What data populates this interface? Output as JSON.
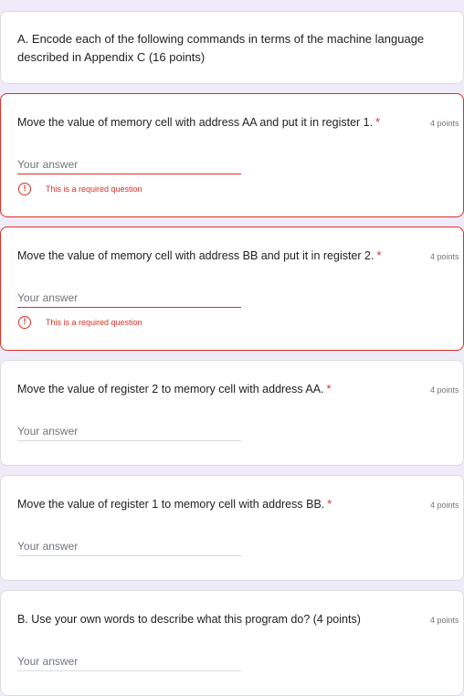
{
  "section_a": {
    "text": "A. Encode each of the following commands in terms of the machine language described in Appendix C (16 points)"
  },
  "questions": [
    {
      "title": "Move the value of memory cell with address AA and put it in register 1.",
      "required_mark": "*",
      "points": "4 points",
      "placeholder": "Your answer",
      "error": "This is a required question",
      "error_icon": "exclamation-circle-icon"
    },
    {
      "title": "Move the value of memory cell with address BB and put it in register 2.",
      "required_mark": "*",
      "points": "4 points",
      "placeholder": "Your answer",
      "error": "This is a required question",
      "error_icon": "exclamation-circle-icon"
    },
    {
      "title": "Move the value of register 2 to memory cell with address AA.",
      "required_mark": "*",
      "points": "4 points",
      "placeholder": "Your answer"
    },
    {
      "title": "Move the value of register 1 to memory cell with address BB.",
      "required_mark": "*",
      "points": "4 points",
      "placeholder": "Your answer"
    },
    {
      "title": "B. Use your own words to describe what this program do? (4 points)",
      "points": "4 points",
      "placeholder": "Your answer"
    }
  ],
  "colors": {
    "background": "#f0ebf8",
    "card": "#ffffff",
    "error": "#d93025",
    "muted": "#70757a"
  }
}
